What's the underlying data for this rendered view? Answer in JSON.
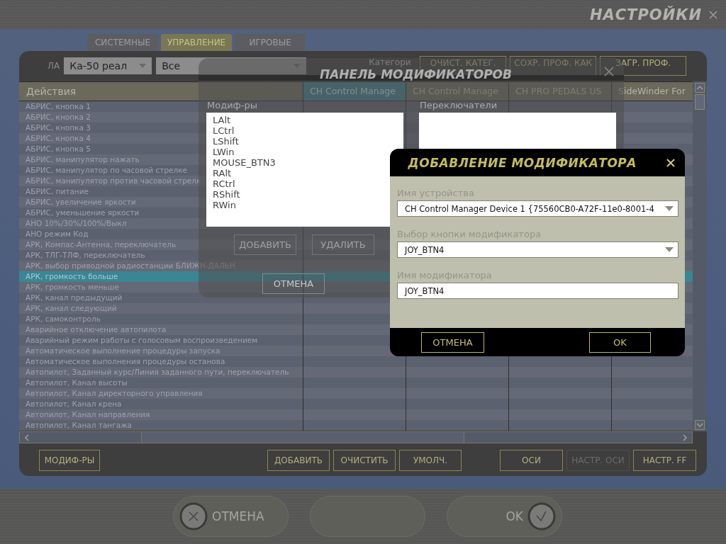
{
  "window": {
    "title": "НАСТРОЙКИ"
  },
  "tabs": [
    {
      "label": "СИСТЕМНЫЕ",
      "selected": false
    },
    {
      "label": "УПРАВЛЕНИЕ",
      "selected": true
    },
    {
      "label": "ИГРОВЫЕ",
      "selected": false
    }
  ],
  "toolbar": {
    "aircraft_label": "ЛА",
    "aircraft": "Ка-50 реал",
    "category_filter": "Все",
    "category_label": "Категори",
    "buttons": [
      "ОЧИСТ. КАТЕГ.",
      "СОХР. ПРОФ. КАК",
      "ЗАГР. ПРОФ."
    ]
  },
  "table": {
    "columns": [
      {
        "label": "Действия",
        "selected": false
      },
      {
        "label": "CH Control Manage",
        "selected": true
      },
      {
        "label": "CH Control Manage",
        "selected": false
      },
      {
        "label": "CH PRO PEDALS US",
        "selected": false
      },
      {
        "label": "SideWinder For",
        "selected": false
      }
    ],
    "rows": [
      {
        "action": "АБРИС, кнопка 1",
        "selected": false
      },
      {
        "action": "АБРИС, кнопка 2",
        "selected": false
      },
      {
        "action": "АБРИС, кнопка 3",
        "selected": false
      },
      {
        "action": "АБРИС, кнопка 4",
        "selected": false
      },
      {
        "action": "АБРИС, кнопка 5",
        "selected": false
      },
      {
        "action": "АБРИС, манипулятор нажать",
        "selected": false
      },
      {
        "action": "АБРИС, манипулятор по часовой стрелке",
        "selected": false
      },
      {
        "action": "АБРИС, манипулятор против часовой стрелк",
        "selected": false
      },
      {
        "action": "АБРИС, питание",
        "selected": false
      },
      {
        "action": "АБРИС, увеличение яркости",
        "selected": false
      },
      {
        "action": "АБРИС, уменьшение яркости",
        "selected": false
      },
      {
        "action": "АНО 10%/30%/100%/Выкл",
        "selected": false
      },
      {
        "action": "АНО режим Код",
        "selected": false
      },
      {
        "action": "АРК, Компас-Антенна, переключатель",
        "selected": false
      },
      {
        "action": "АРК, ТЛГ-ТЛФ, переключатель",
        "selected": false
      },
      {
        "action": "АРК, выбор приводной радиостанции БЛИЖН-ДАЛЬН",
        "selected": false
      },
      {
        "action": "АРК, громкость больше",
        "selected": true
      },
      {
        "action": "АРК, громкость меньше",
        "selected": false
      },
      {
        "action": "АРК, канал предыдущий",
        "selected": false
      },
      {
        "action": "АРК, канал следующий",
        "selected": false
      },
      {
        "action": "АРК, самоконтроль",
        "selected": false
      },
      {
        "action": "Аварийное отключение автопилота",
        "selected": false
      },
      {
        "action": "Аварийный режим работы с голосовым воспроизведением",
        "selected": false
      },
      {
        "action": "Автоматическое выполнение процедуры запуска",
        "selected": false
      },
      {
        "action": "Автоматическое выполнения процедуры останова",
        "selected": false
      },
      {
        "action": "Автопилот, Заданный курс/Линия заданного пути, переключатель",
        "selected": false
      },
      {
        "action": "Автопилот, Канал высоты",
        "selected": false
      },
      {
        "action": "Автопилот, Канал директорного управления",
        "selected": false
      },
      {
        "action": "Автопилот, Канал крена",
        "selected": false
      },
      {
        "action": "Автопилот, Канал направления",
        "selected": false
      },
      {
        "action": "Автопилот, Канал тангажа",
        "selected": false
      }
    ]
  },
  "bottom_buttons": {
    "left": [
      {
        "label": "МОДИФ-РЫ",
        "disabled": false
      }
    ],
    "middle": [
      {
        "label": "ДОБАВИТЬ",
        "disabled": false
      },
      {
        "label": "ОЧИСТИТЬ",
        "disabled": false
      },
      {
        "label": "УМОЛЧ.",
        "disabled": false
      }
    ],
    "right": [
      {
        "label": "ОСИ",
        "disabled": false
      },
      {
        "label": "НАСТР. ОСИ",
        "disabled": true
      },
      {
        "label": "НАСТР. FF",
        "disabled": false
      }
    ]
  },
  "footer": {
    "cancel": "ОТМЕНА",
    "ok": "OK"
  },
  "modifier_panel": {
    "title": "ПАНЕЛЬ МОДИФИКАТОРОВ",
    "modifiers_label": "Модиф-ры",
    "modifiers": [
      "LAlt",
      "LCtrl",
      "LShift",
      "LWin",
      "MOUSE_BTN3",
      "RAlt",
      "RCtrl",
      "RShift",
      "RWin"
    ],
    "switches_label": "Переключатели",
    "buttons": [
      {
        "label": "ДОБАВИТЬ",
        "disabled": true
      },
      {
        "label": "УДАЛИТЬ",
        "disabled": true
      }
    ],
    "cancel": "ОТМЕНА"
  },
  "dialog": {
    "title": "ДОБАВЛЕНИЕ МОДИФИКАТОРА",
    "fields": [
      {
        "label": "Имя устройства",
        "value": "CH Control Manager Device 1 {75560CB0-A72F-11e0-8001-4",
        "kind": "dropdown"
      },
      {
        "label": "Выбор кнопки модификатора",
        "value": "JOY_BTN4",
        "kind": "dropdown"
      },
      {
        "label": "Имя модификатора",
        "value": "JOY_BTN4",
        "kind": "text"
      }
    ],
    "buttons": [
      "ОТМЕНА",
      "OK"
    ]
  }
}
